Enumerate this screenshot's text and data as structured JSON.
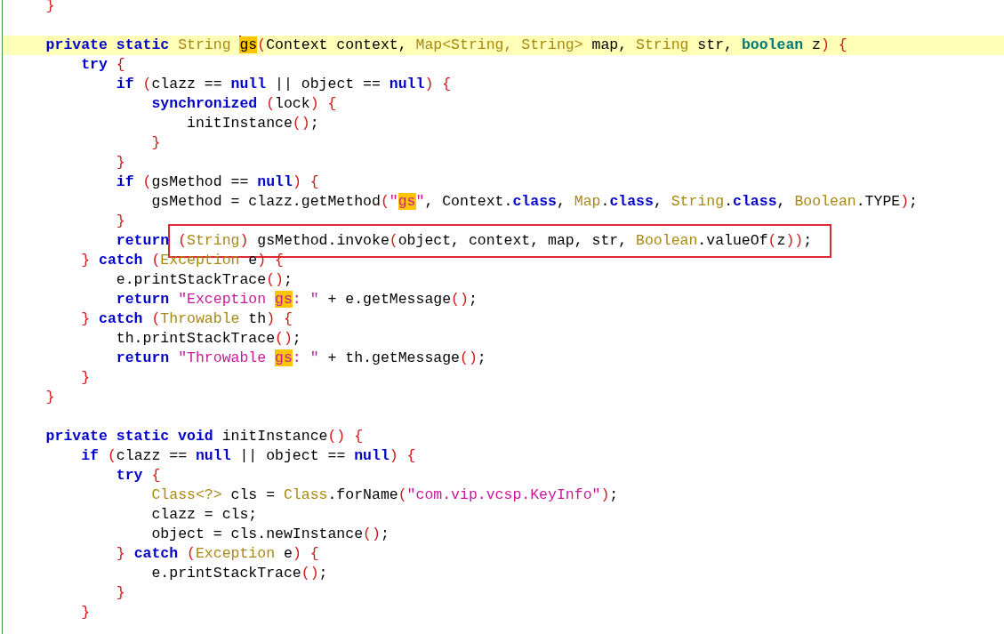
{
  "editor": {
    "lines": [
      {
        "current": false,
        "tokens": [
          {
            "text": "}",
            "kind": "punct"
          }
        ]
      },
      {
        "current": false
      },
      {
        "current": true,
        "tokens": [
          {
            "text": "private static ",
            "kind": "kw"
          },
          {
            "text": "String ",
            "kind": "type"
          },
          {
            "kind": "caret"
          },
          {
            "text": "gs",
            "kind": "match-ident"
          },
          {
            "text": "(",
            "kind": "punct"
          },
          {
            "text": "Context context, ",
            "kind": "plain"
          },
          {
            "text": "Map<String, String>",
            "kind": "type"
          },
          {
            "text": " map, ",
            "kind": "plain"
          },
          {
            "text": "String",
            "kind": "type"
          },
          {
            "text": " str, ",
            "kind": "plain"
          },
          {
            "text": "boolean",
            "kind": "prim"
          },
          {
            "text": " z",
            "kind": "plain"
          },
          {
            "text": ") {",
            "kind": "punct"
          }
        ],
        "children": [
          {
            "current": false,
            "tokens": [
              {
                "text": "try ",
                "kind": "kw"
              },
              {
                "text": "{",
                "kind": "punct"
              }
            ],
            "children": [
              {
                "current": false,
                "tokens": [
                  {
                    "text": "if ",
                    "kind": "kw"
                  },
                  {
                    "text": "(",
                    "kind": "punct"
                  },
                  {
                    "text": "clazz == ",
                    "kind": "plain"
                  },
                  {
                    "text": "null",
                    "kind": "kw"
                  },
                  {
                    "text": " || object == ",
                    "kind": "plain"
                  },
                  {
                    "text": "null",
                    "kind": "kw"
                  },
                  {
                    "text": ") {",
                    "kind": "punct"
                  }
                ],
                "children": [
                  {
                    "current": false,
                    "tokens": [
                      {
                        "text": "synchronized ",
                        "kind": "kw"
                      },
                      {
                        "text": "(",
                        "kind": "punct"
                      },
                      {
                        "text": "lock",
                        "kind": "plain"
                      },
                      {
                        "text": ") {",
                        "kind": "punct"
                      }
                    ],
                    "children": [
                      {
                        "current": false,
                        "tokens": [
                          {
                            "text": "initInstance",
                            "kind": "plain"
                          },
                          {
                            "text": "()",
                            "kind": "punct"
                          },
                          {
                            "text": ";",
                            "kind": "plain"
                          }
                        ]
                      }
                    ]
                  },
                  {
                    "current": false,
                    "tokens": [
                      {
                        "text": "}",
                        "kind": "punct"
                      }
                    ]
                  }
                ]
              },
              {
                "current": false,
                "tokens": [
                  {
                    "text": "}",
                    "kind": "punct"
                  }
                ]
              },
              {
                "current": false,
                "tokens": [
                  {
                    "text": "if ",
                    "kind": "kw"
                  },
                  {
                    "text": "(",
                    "kind": "punct"
                  },
                  {
                    "text": "gsMethod == ",
                    "kind": "plain"
                  },
                  {
                    "text": "null",
                    "kind": "kw"
                  },
                  {
                    "text": ") {",
                    "kind": "punct"
                  }
                ],
                "children": [
                  {
                    "current": false,
                    "tokens": [
                      {
                        "text": "gsMethod = clazz.getMethod",
                        "kind": "plain"
                      },
                      {
                        "text": "(",
                        "kind": "punct"
                      },
                      {
                        "text": "\"",
                        "kind": "str"
                      },
                      {
                        "text": "gs",
                        "kind": "match-str"
                      },
                      {
                        "text": "\"",
                        "kind": "str"
                      },
                      {
                        "text": ", Context.",
                        "kind": "plain"
                      },
                      {
                        "text": "class",
                        "kind": "kw"
                      },
                      {
                        "text": ", ",
                        "kind": "plain"
                      },
                      {
                        "text": "Map",
                        "kind": "type"
                      },
                      {
                        "text": ".",
                        "kind": "plain"
                      },
                      {
                        "text": "class",
                        "kind": "kw"
                      },
                      {
                        "text": ", ",
                        "kind": "plain"
                      },
                      {
                        "text": "String",
                        "kind": "type"
                      },
                      {
                        "text": ".",
                        "kind": "plain"
                      },
                      {
                        "text": "class",
                        "kind": "kw"
                      },
                      {
                        "text": ", ",
                        "kind": "plain"
                      },
                      {
                        "text": "Boolean",
                        "kind": "type"
                      },
                      {
                        "text": ".TYPE",
                        "kind": "plain"
                      },
                      {
                        "text": ")",
                        "kind": "punct"
                      },
                      {
                        "text": ";",
                        "kind": "plain"
                      }
                    ]
                  }
                ]
              },
              {
                "current": false,
                "tokens": [
                  {
                    "text": "}",
                    "kind": "punct"
                  }
                ]
              },
              {
                "current": false,
                "tokens": [
                  {
                    "text": "return ",
                    "kind": "kw"
                  }
                ],
                "boxed": [
                  {
                    "text": "(",
                    "kind": "punct"
                  },
                  {
                    "text": "String",
                    "kind": "type"
                  },
                  {
                    "text": ")",
                    "kind": "punct"
                  },
                  {
                    "text": " gsMethod.invoke",
                    "kind": "plain"
                  },
                  {
                    "text": "(",
                    "kind": "punct"
                  },
                  {
                    "text": "object, context, map, str, ",
                    "kind": "plain"
                  },
                  {
                    "text": "Boolean",
                    "kind": "type"
                  },
                  {
                    "text": ".valueOf",
                    "kind": "plain"
                  },
                  {
                    "text": "(",
                    "kind": "punct"
                  },
                  {
                    "text": "z",
                    "kind": "plain"
                  },
                  {
                    "text": "))",
                    "kind": "punct"
                  },
                  {
                    "text": ";",
                    "kind": "plain"
                  }
                ]
              }
            ]
          },
          {
            "current": false,
            "tokens": [
              {
                "text": "} ",
                "kind": "punct"
              },
              {
                "text": "catch ",
                "kind": "kw"
              },
              {
                "text": "(",
                "kind": "punct"
              },
              {
                "text": "Exception",
                "kind": "type"
              },
              {
                "text": " e",
                "kind": "plain"
              },
              {
                "text": ") {",
                "kind": "punct"
              }
            ],
            "children": [
              {
                "current": false,
                "tokens": [
                  {
                    "text": "e.printStackTrace",
                    "kind": "plain"
                  },
                  {
                    "text": "()",
                    "kind": "punct"
                  },
                  {
                    "text": ";",
                    "kind": "plain"
                  }
                ]
              },
              {
                "current": false,
                "tokens": [
                  {
                    "text": "return ",
                    "kind": "kw"
                  },
                  {
                    "text": "\"Exception ",
                    "kind": "str"
                  },
                  {
                    "text": "gs",
                    "kind": "match-str"
                  },
                  {
                    "text": ": \"",
                    "kind": "str"
                  },
                  {
                    "text": " + e.getMessage",
                    "kind": "plain"
                  },
                  {
                    "text": "()",
                    "kind": "punct"
                  },
                  {
                    "text": ";",
                    "kind": "plain"
                  }
                ]
              }
            ]
          },
          {
            "current": false,
            "tokens": [
              {
                "text": "} ",
                "kind": "punct"
              },
              {
                "text": "catch ",
                "kind": "kw"
              },
              {
                "text": "(",
                "kind": "punct"
              },
              {
                "text": "Throwable",
                "kind": "type"
              },
              {
                "text": " th",
                "kind": "plain"
              },
              {
                "text": ") {",
                "kind": "punct"
              }
            ],
            "children": [
              {
                "current": false,
                "tokens": [
                  {
                    "text": "th.printStackTrace",
                    "kind": "plain"
                  },
                  {
                    "text": "()",
                    "kind": "punct"
                  },
                  {
                    "text": ";",
                    "kind": "plain"
                  }
                ]
              },
              {
                "current": false,
                "tokens": [
                  {
                    "text": "return ",
                    "kind": "kw"
                  },
                  {
                    "text": "\"Throwable ",
                    "kind": "str"
                  },
                  {
                    "text": "gs",
                    "kind": "match-str"
                  },
                  {
                    "text": ": \"",
                    "kind": "str"
                  },
                  {
                    "text": " + th.getMessage",
                    "kind": "plain"
                  },
                  {
                    "text": "()",
                    "kind": "punct"
                  },
                  {
                    "text": ";",
                    "kind": "plain"
                  }
                ]
              }
            ]
          },
          {
            "current": false,
            "tokens": [
              {
                "text": "}",
                "kind": "punct"
              }
            ]
          }
        ]
      },
      {
        "current": false,
        "tokens": [
          {
            "text": "}",
            "kind": "punct"
          }
        ]
      },
      {
        "current": false
      },
      {
        "current": false,
        "tokens": [
          {
            "text": "private static void",
            "kind": "kw"
          },
          {
            "text": " initInstance",
            "kind": "plain"
          },
          {
            "text": "() {",
            "kind": "punct"
          }
        ],
        "children": [
          {
            "current": false,
            "tokens": [
              {
                "text": "if ",
                "kind": "kw"
              },
              {
                "text": "(",
                "kind": "punct"
              },
              {
                "text": "clazz == ",
                "kind": "plain"
              },
              {
                "text": "null",
                "kind": "kw"
              },
              {
                "text": " || object == ",
                "kind": "plain"
              },
              {
                "text": "null",
                "kind": "kw"
              },
              {
                "text": ") {",
                "kind": "punct"
              }
            ],
            "children": [
              {
                "current": false,
                "tokens": [
                  {
                    "text": "try ",
                    "kind": "kw"
                  },
                  {
                    "text": "{",
                    "kind": "punct"
                  }
                ],
                "children": [
                  {
                    "current": false,
                    "tokens": [
                      {
                        "text": "Class<?>",
                        "kind": "type"
                      },
                      {
                        "text": " cls = ",
                        "kind": "plain"
                      },
                      {
                        "text": "Class",
                        "kind": "type"
                      },
                      {
                        "text": ".forName",
                        "kind": "plain"
                      },
                      {
                        "text": "(",
                        "kind": "punct"
                      },
                      {
                        "text": "\"com.vip.vcsp.KeyInfo\"",
                        "kind": "str"
                      },
                      {
                        "text": ")",
                        "kind": "punct"
                      },
                      {
                        "text": ";",
                        "kind": "plain"
                      }
                    ]
                  },
                  {
                    "current": false,
                    "tokens": [
                      {
                        "text": "clazz = cls;",
                        "kind": "plain"
                      }
                    ]
                  },
                  {
                    "current": false,
                    "tokens": [
                      {
                        "text": "object = cls.newInstance",
                        "kind": "plain"
                      },
                      {
                        "text": "()",
                        "kind": "punct"
                      },
                      {
                        "text": ";",
                        "kind": "plain"
                      }
                    ]
                  }
                ]
              },
              {
                "current": false,
                "tokens": [
                  {
                    "text": "} ",
                    "kind": "punct"
                  },
                  {
                    "text": "catch ",
                    "kind": "kw"
                  },
                  {
                    "text": "(",
                    "kind": "punct"
                  },
                  {
                    "text": "Exception",
                    "kind": "type"
                  },
                  {
                    "text": " e",
                    "kind": "plain"
                  },
                  {
                    "text": ") {",
                    "kind": "punct"
                  }
                ],
                "children": [
                  {
                    "current": false,
                    "tokens": [
                      {
                        "text": "e.printStackTrace",
                        "kind": "plain"
                      },
                      {
                        "text": "()",
                        "kind": "punct"
                      },
                      {
                        "text": ";",
                        "kind": "plain"
                      }
                    ]
                  }
                ]
              },
              {
                "current": false,
                "tokens": [
                  {
                    "text": "}",
                    "kind": "punct"
                  }
                ]
              }
            ]
          },
          {
            "current": false,
            "tokens": [
              {
                "text": "}",
                "kind": "punct"
              }
            ]
          }
        ]
      }
    ]
  }
}
